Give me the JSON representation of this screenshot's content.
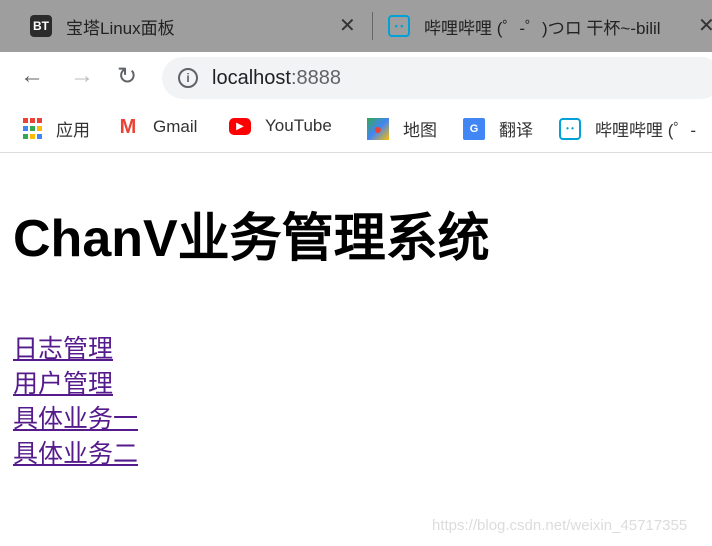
{
  "browser": {
    "tabs": [
      {
        "title": "宝塔Linux面板",
        "favicon": "BT",
        "close": "✕"
      },
      {
        "title": "哔哩哔哩 (゜-゜)つロ 干杯~-bilil",
        "favicon": "bilibili-icon",
        "close": "✕"
      }
    ],
    "address": {
      "host": "localhost",
      "port": ":8888"
    },
    "bookmarks": [
      {
        "label": "应用",
        "icon": "apps-icon"
      },
      {
        "label": "Gmail",
        "icon": "gmail-icon"
      },
      {
        "label": "YouTube",
        "icon": "youtube-icon"
      },
      {
        "label": "地图",
        "icon": "maps-icon"
      },
      {
        "label": "翻译",
        "icon": "translate-icon"
      },
      {
        "label": "哔哩哔哩 (゜-",
        "icon": "bilibili-icon"
      }
    ]
  },
  "page": {
    "title": "ChanV业务管理系统",
    "links": [
      "日志管理",
      "用户管理",
      "具体业务一",
      "具体业务二"
    ],
    "link_color": "#551a8b"
  },
  "watermark": "https://blog.csdn.net/weixin_45717355"
}
